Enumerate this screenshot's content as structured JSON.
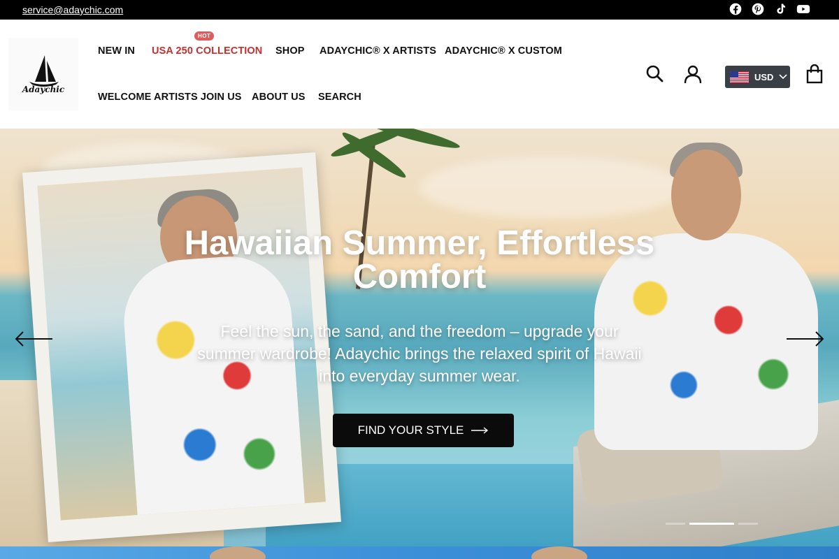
{
  "topbar": {
    "email": "service@adaychic.com",
    "social": [
      "facebook-icon",
      "pinterest-icon",
      "tiktok-icon",
      "youtube-icon"
    ]
  },
  "brand": {
    "logo_text": "Adaychic"
  },
  "nav": {
    "hot_badge": "HOT",
    "items": [
      {
        "label": "NEW IN"
      },
      {
        "label": "USA 250 COLLECTION"
      },
      {
        "label": "SHOP"
      },
      {
        "label": "ADAYCHIC® X ARTISTS"
      },
      {
        "label": "ADAYCHIC® X CUSTOM"
      },
      {
        "label": "WELCOME ARTISTS JOIN US"
      },
      {
        "label": "ABOUT US"
      },
      {
        "label": "SEARCH"
      }
    ]
  },
  "header_actions": {
    "currency": "USD",
    "icons": [
      "search-icon",
      "account-icon",
      "flag-icon",
      "cart-icon"
    ]
  },
  "hero": {
    "title": "Hawaiian Summer, Effortless Comfort",
    "subtitle": "Feel the sun, the sand, and the freedom – upgrade your summer wardrobe! Adaychic brings the relaxed spirit of Hawaii into everyday summer wear.",
    "cta_label": "FIND YOUR STYLE",
    "slides_total": 3,
    "active_slide": 2
  },
  "colors": {
    "topbar_bg": "#000000",
    "hot_nav": "#c62f2f",
    "hot_badge": "#e05b5b",
    "currency_bg": "#3a3f45",
    "cta_bg": "#0b0b0b"
  }
}
